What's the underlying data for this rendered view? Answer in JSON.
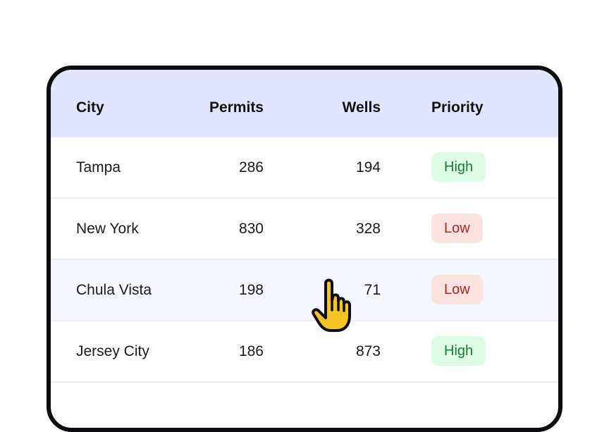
{
  "table": {
    "headers": {
      "city": "City",
      "permits": "Permits",
      "wells": "Wells",
      "priority": "Priority"
    },
    "rows": [
      {
        "city": "Tampa",
        "permits": "286",
        "wells": "194",
        "priority": "High"
      },
      {
        "city": "New York",
        "permits": "830",
        "wells": "328",
        "priority": "Low"
      },
      {
        "city": "Chula Vista",
        "permits": "198",
        "wells": "71",
        "priority": "Low"
      },
      {
        "city": "Jersey City",
        "permits": "186",
        "wells": "873",
        "priority": "High"
      }
    ],
    "hovered_row": 2
  },
  "colors": {
    "header_bg": "#e3e4fd",
    "hover_row_bg": "#f5f6fe",
    "high_badge_bg": "#dcfce5",
    "high_badge_text": "#1b7a33",
    "low_badge_bg": "#fde2e2",
    "low_badge_text": "#b3261e",
    "cursor_fill": "#f7c325"
  },
  "cursor": {
    "icon": "hand-pointer-icon"
  }
}
